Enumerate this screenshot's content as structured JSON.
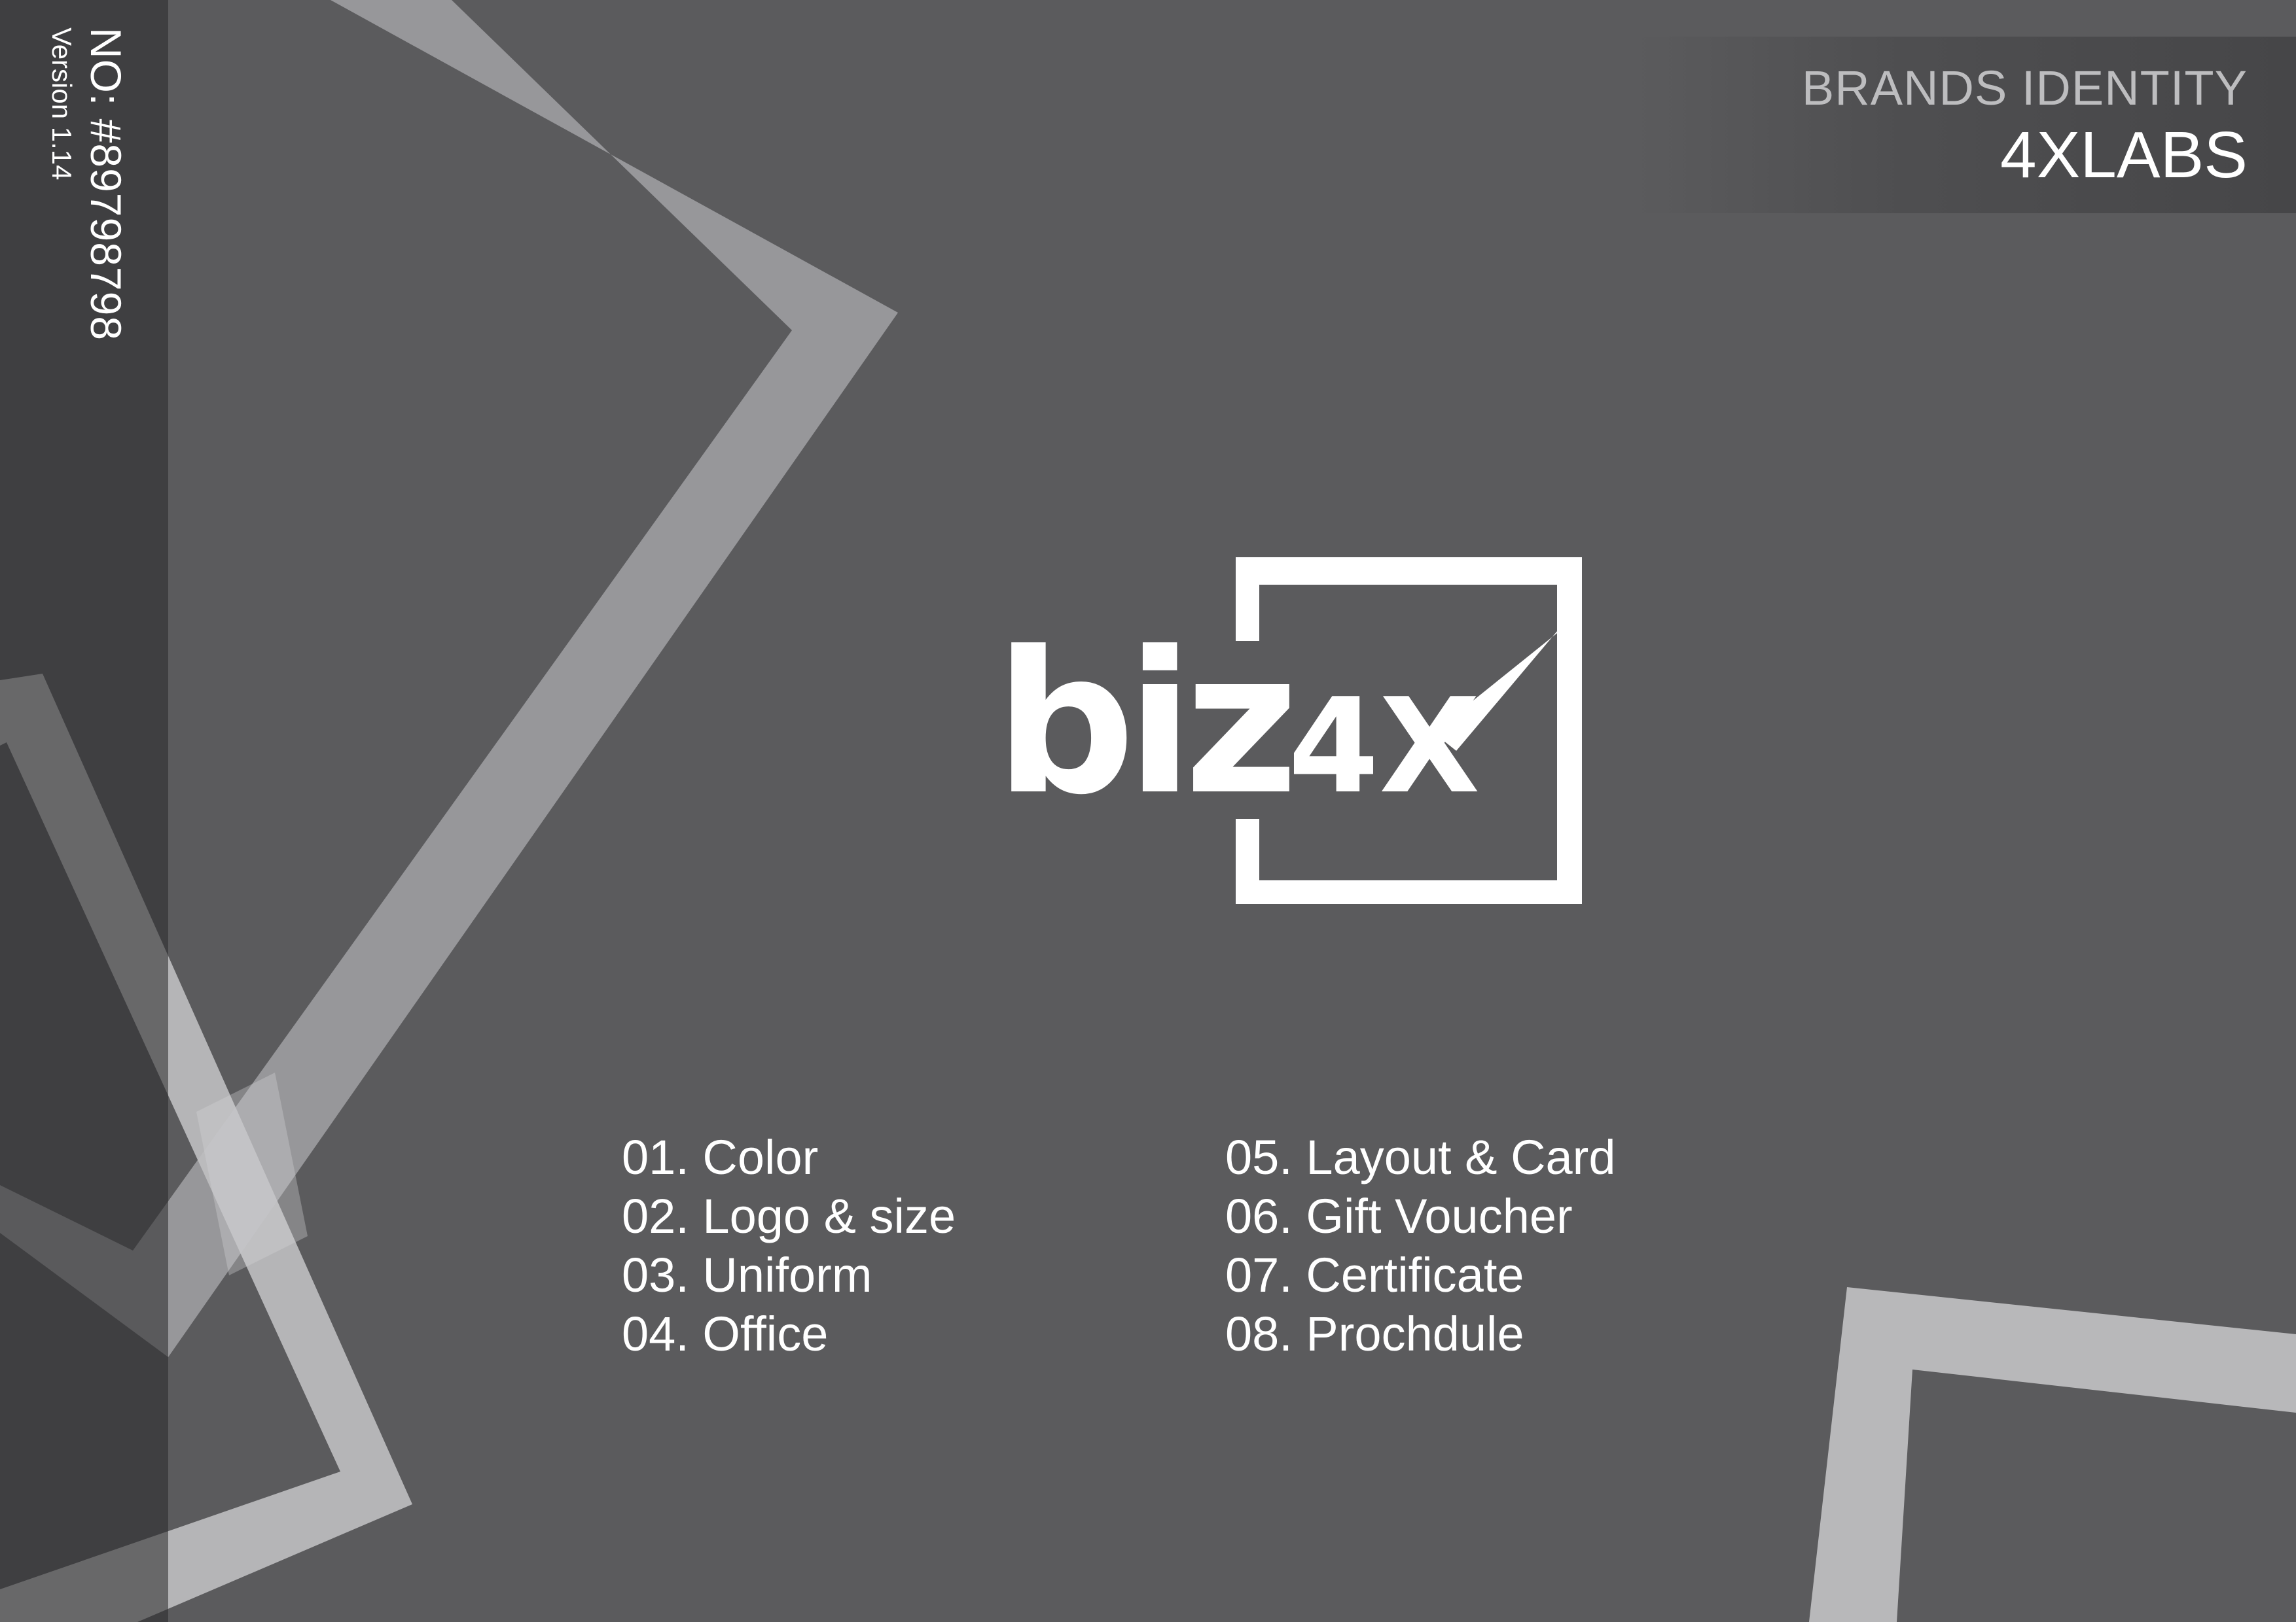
{
  "sidebar": {
    "number_label": "NO: #89798798",
    "version_label": "Version 1.14"
  },
  "header": {
    "subtitle": "BRANDS IDENTITY",
    "title": "4XLABS"
  },
  "logo": {
    "wordmark": "biz",
    "mark": "4X"
  },
  "toc": {
    "left": [
      "01. Color",
      "02. Logo & size",
      "03. Uniform",
      "04. Office"
    ],
    "right": [
      "05. Layout & Card",
      "06. Gift Voucher",
      "07. Certificate",
      "08. Prochdule"
    ]
  },
  "colors": {
    "background": "#5b5b5d",
    "sidebar": "#3f3f41",
    "frame_light": "#97979a",
    "frame_lighter": "#b9b9bb",
    "text": "#ffffff"
  }
}
